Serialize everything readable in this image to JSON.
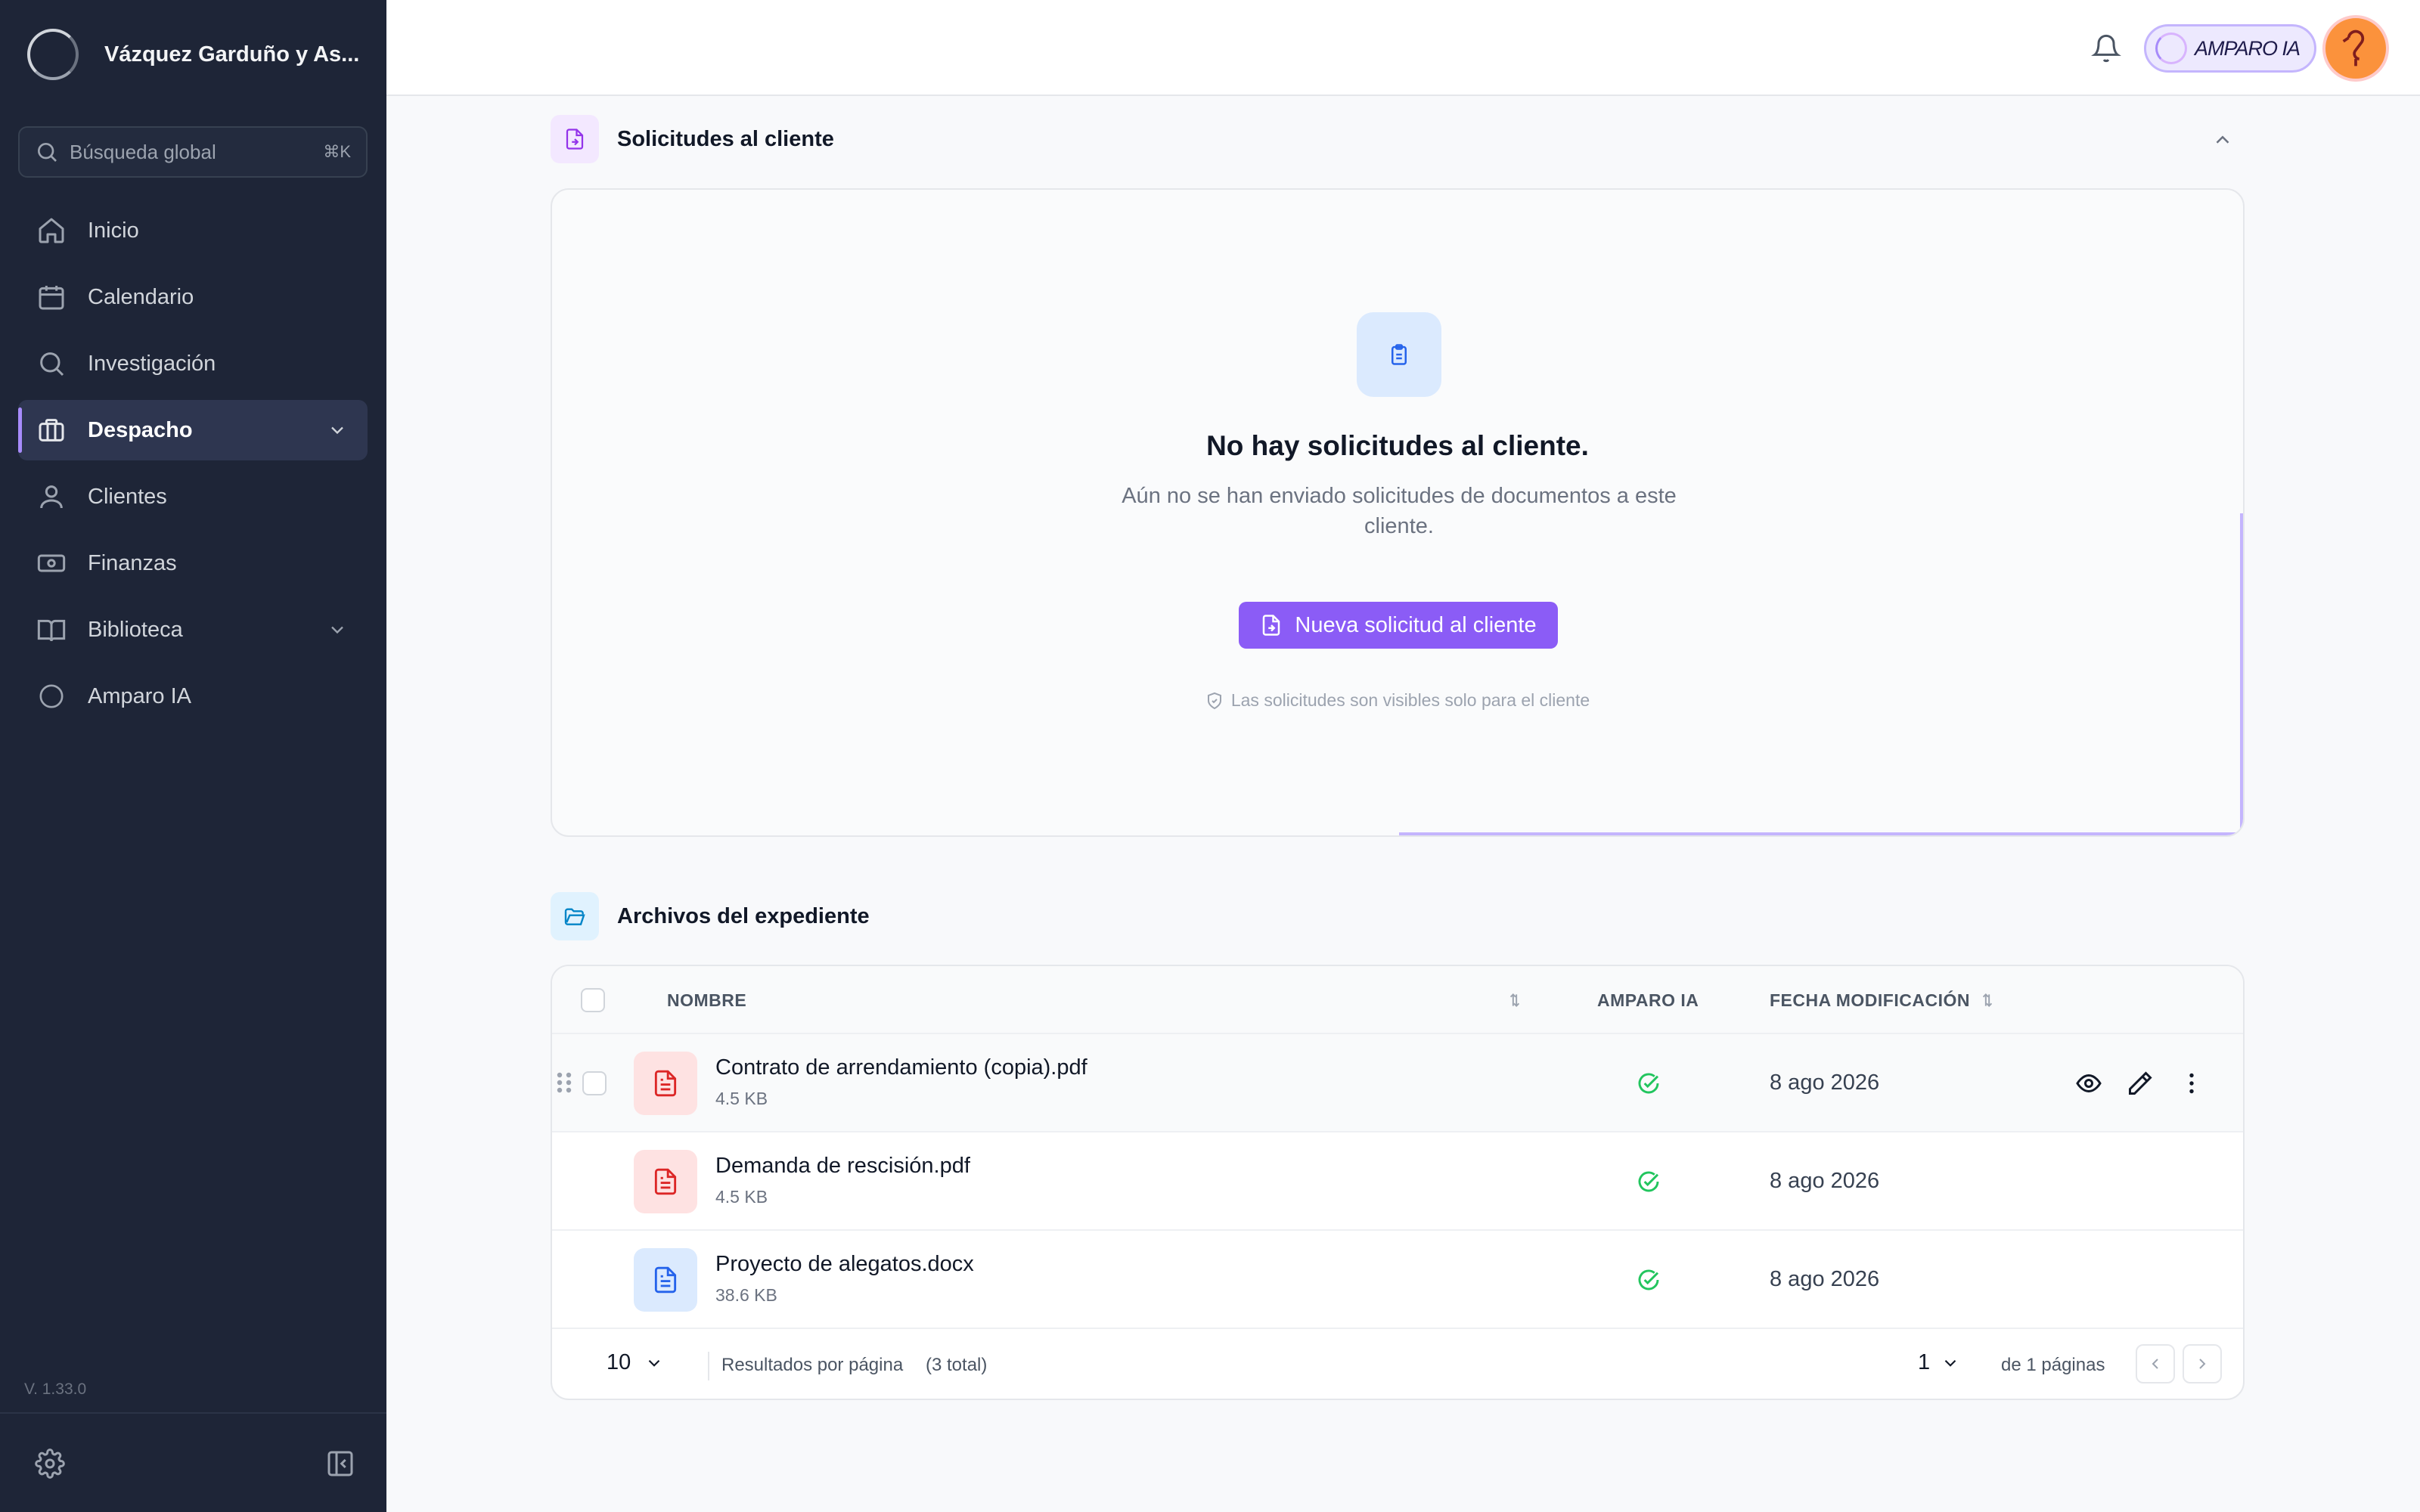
{
  "sidebar": {
    "firm_name": "Vázquez Garduño y As...",
    "search_placeholder": "Búsqueda global",
    "search_shortcut": "⌘K",
    "items": [
      {
        "label": "Inicio",
        "icon": "home-icon"
      },
      {
        "label": "Calendario",
        "icon": "calendar-icon"
      },
      {
        "label": "Investigación",
        "icon": "search-icon"
      },
      {
        "label": "Despacho",
        "icon": "briefcase-icon",
        "active": true,
        "expandable": true
      },
      {
        "label": "Clientes",
        "icon": "user-icon"
      },
      {
        "label": "Finanzas",
        "icon": "banknote-icon"
      },
      {
        "label": "Biblioteca",
        "icon": "book-icon",
        "expandable": true
      },
      {
        "label": "Amparo IA",
        "icon": "amparo-ring-icon"
      }
    ],
    "version": "V. 1.33.0"
  },
  "topbar": {
    "ai_button_label": "AMPARO IA"
  },
  "requests": {
    "title": "Solicitudes al cliente",
    "empty_title": "No hay solicitudes al cliente.",
    "empty_description": "Aún no se han enviado solicitudes de documentos a este cliente.",
    "new_button": "Nueva solicitud al cliente",
    "privacy_note": "Las solicitudes son visibles solo para el cliente"
  },
  "files": {
    "title": "Archivos del expediente",
    "columns": {
      "name": "NOMBRE",
      "ai": "AMPARO IA",
      "modified": "FECHA MODIFICACIÓN"
    },
    "rows": [
      {
        "name": "Contrato de arrendamiento (copia).pdf",
        "size": "4.5 KB",
        "type": "pdf",
        "ai_status": "check-circle-icon",
        "date": "8 ago 2026"
      },
      {
        "name": "Demanda de rescisión.pdf",
        "size": "4.5 KB",
        "type": "pdf",
        "ai_status": "check-circle-icon",
        "date": "8 ago 2026"
      },
      {
        "name": "Proyecto de alegatos.docx",
        "size": "38.6 KB",
        "type": "docx",
        "ai_status": "check-circle-icon",
        "date": "8 ago 2026"
      }
    ],
    "pagination": {
      "per_page": "10",
      "per_page_label": "Resultados por página",
      "total": "(3 total)",
      "current_page": "1",
      "pages_label": "de 1 páginas"
    }
  },
  "colors": {
    "sidebar_bg": "#1e2537",
    "accent": "#8b5cf6",
    "success": "#22c55e",
    "pdf": "#dc2626",
    "docx": "#2563eb"
  }
}
